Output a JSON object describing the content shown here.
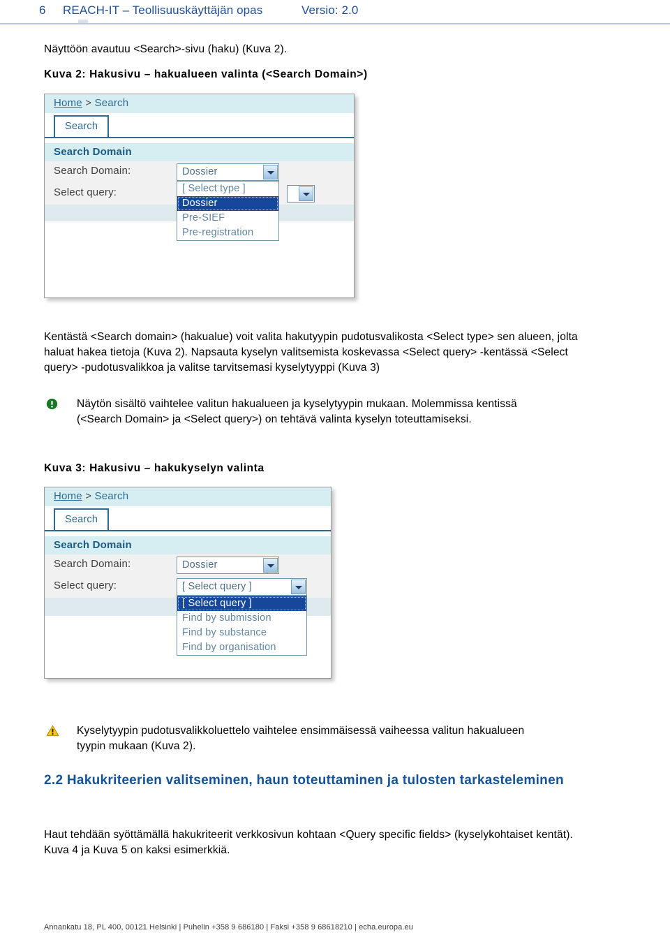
{
  "header": {
    "page_number": "6",
    "title": "REACH-IT – Teollisuuskäyttäjän opas",
    "version": "Versio: 2.0",
    "color": "#1f4e9c"
  },
  "intro_paragraph": "Näyttöön avautuu <Search>-sivu (haku) (Kuva 2).",
  "figure2": {
    "caption": "Kuva 2: Hakusivu – hakualueen valinta (<Search Domain>)",
    "breadcrumb": {
      "home": "Home",
      "separator": ">",
      "current": "Search"
    },
    "tab": "Search",
    "section_bar": "Search Domain",
    "rows": [
      {
        "label": "Search Domain:"
      },
      {
        "label": "Select query:"
      }
    ],
    "domain_combo": {
      "value": "Dossier"
    },
    "query_combo": {
      "value": ""
    },
    "open_list": {
      "options": [
        "[ Select type ]",
        "Dossier",
        "Pre-SIEF",
        "Pre-registration"
      ],
      "selected": "Dossier",
      "selected_index": 1
    }
  },
  "body_paragraph": "Kentästä <Search domain> (hakualue) voit valita hakutyypin pudotusvalikosta <Select type> sen alueen, jolta haluat hakea tietoja (Kuva 2). Napsauta kyselyn valitsemista koskevassa <Select query> -kentässä <Select query> -pudotusvalikkoa ja valitse tarvitsemasi kyselytyyppi (Kuva 3)",
  "note_info": {
    "icon": "info-circle-icon",
    "icon_color": "#177a22",
    "text": "Näytön sisältö vaihtelee valitun hakualueen ja kyselytyypin mukaan. Molemmissa kentissä (<Search Domain> ja <Select query>) on tehtävä valinta kyselyn toteuttamiseksi."
  },
  "figure3": {
    "caption": "Kuva 3: Hakusivu – hakukyselyn valinta",
    "breadcrumb": {
      "home": "Home",
      "separator": ">",
      "current": "Search"
    },
    "tab": "Search",
    "section_bar": "Search Domain",
    "rows": [
      {
        "label": "Search Domain:"
      },
      {
        "label": "Select query:"
      }
    ],
    "domain_combo": {
      "value": "Dossier"
    },
    "query_combo": {
      "value": "[ Select query ]"
    },
    "open_list": {
      "options": [
        "[ Select query ]",
        "Find by submission",
        "Find by substance",
        "Find by organisation"
      ],
      "selected": "[ Select query ]",
      "selected_index": 0
    }
  },
  "note_warning": {
    "icon": "warning-triangle-icon",
    "icon_color": "#f0c419",
    "text": "Kyselytyypin pudotusvalikkoluettelo vaihtelee ensimmäisessä vaiheessa valitun hakualueen tyypin mukaan (Kuva 2)."
  },
  "section": {
    "heading": "2.2 Hakukriteerien valitseminen, haun toteuttaminen ja tulosten tarkasteleminen",
    "color": "#14539a",
    "paragraph": "Haut tehdään syöttämällä hakukriteerit verkkosivun kohtaan <Query specific fields> (kyselykohtaiset kentät). Kuva 4 ja Kuva 5 on kaksi esimerkkiä."
  },
  "footer": {
    "text": "Annankatu 18, PL 400, 00121 Helsinki | Puhelin +358 9 686180 | Faksi +358 9 68618210 | echa.europa.eu"
  }
}
